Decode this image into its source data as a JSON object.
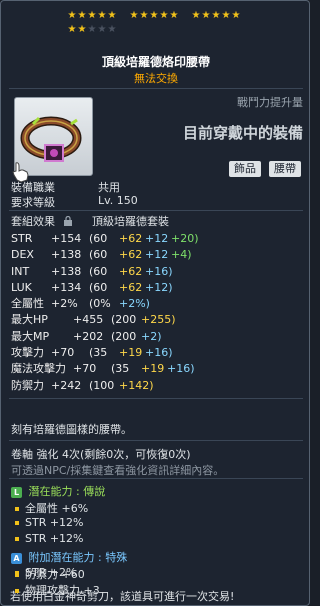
{
  "stars": {
    "row1_groups": [
      5,
      5,
      5
    ],
    "row2_filled": 2,
    "row2_total": 5
  },
  "item": {
    "name": "頂級培羅德烙印腰帶",
    "untradeable": "無法交換",
    "icon": "belt-icon"
  },
  "combat_power": {
    "label": "戰鬥力提升量",
    "value": "目前穿戴中的裝備"
  },
  "tags": [
    "飾品",
    "腰帶"
  ],
  "requirements": {
    "job_label": "裝備職業",
    "job_value": "共用",
    "level_label": "要求等級",
    "level_value": "Lv. 150"
  },
  "set": {
    "label": "套組效果",
    "name": "頂級培羅德套裝"
  },
  "stats": [
    {
      "name": "STR",
      "total": "+154",
      "base": "(60",
      "flame": "+62",
      "enh": "+12",
      "star": "+20)"
    },
    {
      "name": "DEX",
      "total": "+138",
      "base": "(60",
      "flame": "+62",
      "enh": "+12",
      "star": "+4)"
    },
    {
      "name": "INT",
      "total": "+138",
      "base": "(60",
      "flame": "+62",
      "enh": "+16)",
      "star": ""
    },
    {
      "name": "LUK",
      "total": "+134",
      "base": "(60",
      "flame": "+62",
      "enh": "+12)",
      "star": ""
    },
    {
      "name": "全屬性",
      "total": "+2%",
      "base": "(0%",
      "flame": "",
      "enh": "+2%)",
      "star": ""
    },
    {
      "name": "最大HP",
      "total": "+455",
      "base": "(200",
      "flame": "+255)",
      "enh": "",
      "star": ""
    },
    {
      "name": "最大MP",
      "total": "+202",
      "base": "(200",
      "flame": "",
      "enh": "+2)",
      "star": ""
    },
    {
      "name": "攻擊力",
      "total": "+70",
      "base": "(35",
      "flame": "+19",
      "enh": "+16)",
      "star": ""
    },
    {
      "name": "魔法攻擊力",
      "total": "+70",
      "base": "(35",
      "flame": "+19",
      "enh": "+16)",
      "star": ""
    },
    {
      "name": "防禦力",
      "total": "+242",
      "base": "(100",
      "flame": "+142)",
      "enh": "",
      "star": ""
    }
  ],
  "description": "刻有培羅德圖樣的腰帶。",
  "scroll": "卷軸 強化 4次(剩餘0次，可恢復0次)",
  "hint": "可透過NPC/採集鍵查看強化資訊詳細內容。",
  "potential": {
    "badge": "L",
    "badge_color": "#4caf50",
    "title": "潛在能力 : 傳說",
    "title_color": "#9be05a",
    "lines": [
      "全屬性 +6%",
      "STR +12%",
      "STR +12%"
    ]
  },
  "additional": {
    "badge": "A",
    "badge_color": "#3a8fd8",
    "title": "附加潛在能力 : 特殊",
    "title_color": "#7ac8ff",
    "lines": [
      "STR +2%",
      "防禦力 +60",
      "物理攻擊力 +3"
    ]
  },
  "footer": "若使用白金神奇剪刀，該道具可進行一次交易!"
}
